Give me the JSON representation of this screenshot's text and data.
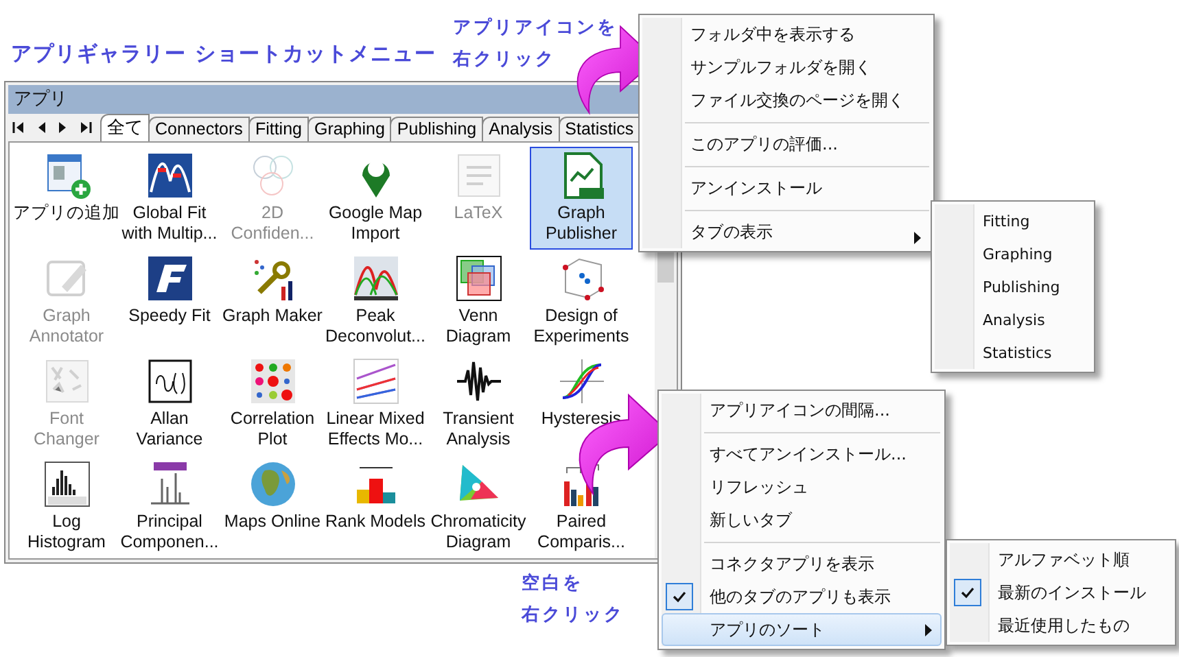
{
  "heading": "アプリギャラリー ショートカットメニュー",
  "notes": [
    {
      "lines": [
        "アプリアイコンを",
        "右クリック"
      ]
    },
    {
      "lines": [
        "空白を",
        "右クリック"
      ]
    }
  ],
  "window": {
    "title": "アプリ",
    "tabs": [
      {
        "label": "全て",
        "selected": true
      },
      {
        "label": "Connectors",
        "selected": false
      },
      {
        "label": "Fitting",
        "selected": false
      },
      {
        "label": "Graphing",
        "selected": false
      },
      {
        "label": "Publishing",
        "selected": false
      },
      {
        "label": "Analysis",
        "selected": false
      },
      {
        "label": "Statistics",
        "selected": false
      }
    ],
    "apps": [
      {
        "label": [
          "アプリの追加"
        ],
        "disabled": false,
        "selected": false
      },
      {
        "label": [
          "Global Fit",
          "with Multip..."
        ],
        "disabled": false,
        "selected": false
      },
      {
        "label": [
          "2D",
          "Confiden..."
        ],
        "disabled": true,
        "selected": false
      },
      {
        "label": [
          "Google Map",
          "Import"
        ],
        "disabled": false,
        "selected": false
      },
      {
        "label": [
          "LaTeX"
        ],
        "disabled": true,
        "selected": false
      },
      {
        "label": [
          "Graph",
          "Publisher"
        ],
        "disabled": false,
        "selected": true
      },
      {
        "label": [
          "Graph",
          "Annotator"
        ],
        "disabled": true,
        "selected": false
      },
      {
        "label": [
          "Speedy Fit"
        ],
        "disabled": false,
        "selected": false
      },
      {
        "label": [
          "Graph Maker"
        ],
        "disabled": false,
        "selected": false
      },
      {
        "label": [
          "Peak",
          "Deconvolut..."
        ],
        "disabled": false,
        "selected": false
      },
      {
        "label": [
          "Venn",
          "Diagram"
        ],
        "disabled": false,
        "selected": false
      },
      {
        "label": [
          "Design of",
          "Experiments"
        ],
        "disabled": false,
        "selected": false
      },
      {
        "label": [
          "Font",
          "Changer"
        ],
        "disabled": true,
        "selected": false
      },
      {
        "label": [
          "Allan",
          "Variance"
        ],
        "disabled": false,
        "selected": false
      },
      {
        "label": [
          "Correlation",
          "Plot"
        ],
        "disabled": false,
        "selected": false
      },
      {
        "label": [
          "Linear Mixed",
          "Effects Mo..."
        ],
        "disabled": false,
        "selected": false
      },
      {
        "label": [
          "Transient",
          "Analysis"
        ],
        "disabled": false,
        "selected": false
      },
      {
        "label": [
          "Hysteresis"
        ],
        "disabled": false,
        "selected": false
      },
      {
        "label": [
          "Log",
          "Histogram"
        ],
        "disabled": false,
        "selected": false
      },
      {
        "label": [
          "Principal",
          "Componen..."
        ],
        "disabled": false,
        "selected": false
      },
      {
        "label": [
          "Maps Online"
        ],
        "disabled": false,
        "selected": false
      },
      {
        "label": [
          "Rank Models"
        ],
        "disabled": false,
        "selected": false
      },
      {
        "label": [
          "Chromaticity",
          "Diagram"
        ],
        "disabled": false,
        "selected": false
      },
      {
        "label": [
          "Paired",
          "Comparis..."
        ],
        "disabled": false,
        "selected": false
      }
    ]
  },
  "icon_menu": {
    "items": [
      {
        "label": "フォルダ中を表示する",
        "separator_before": false,
        "submenu": false
      },
      {
        "label": "サンプルフォルダを開く",
        "separator_before": false,
        "submenu": false
      },
      {
        "label": "ファイル交換のページを開く",
        "separator_before": false,
        "submenu": false
      },
      {
        "label": "このアプリの評価...",
        "separator_before": true,
        "submenu": false
      },
      {
        "label": "アンインストール",
        "separator_before": true,
        "submenu": false
      },
      {
        "label": "タブの表示",
        "separator_before": true,
        "submenu": true
      }
    ],
    "submenu": [
      {
        "label": "Fitting"
      },
      {
        "label": "Graphing"
      },
      {
        "label": "Publishing"
      },
      {
        "label": "Analysis"
      },
      {
        "label": "Statistics"
      }
    ]
  },
  "blank_menu": {
    "items": [
      {
        "label": "アプリアイコンの間隔...",
        "separator_before": false,
        "submenu": false,
        "checked": false,
        "selected": false
      },
      {
        "label": "すべてアンインストール...",
        "separator_before": true,
        "submenu": false,
        "checked": false,
        "selected": false
      },
      {
        "label": "リフレッシュ",
        "separator_before": false,
        "submenu": false,
        "checked": false,
        "selected": false
      },
      {
        "label": "新しいタブ",
        "separator_before": false,
        "submenu": false,
        "checked": false,
        "selected": false
      },
      {
        "label": "コネクタアプリを表示",
        "separator_before": true,
        "submenu": false,
        "checked": false,
        "selected": false
      },
      {
        "label": "他のタブのアプリも表示",
        "separator_before": false,
        "submenu": false,
        "checked": true,
        "selected": false
      },
      {
        "label": "アプリのソート",
        "separator_before": false,
        "submenu": true,
        "checked": false,
        "selected": true
      }
    ],
    "submenu": [
      {
        "label": "アルファベット順",
        "checked": false
      },
      {
        "label": "最新のインストール",
        "checked": true
      },
      {
        "label": "最近使用したもの",
        "checked": false
      }
    ]
  }
}
